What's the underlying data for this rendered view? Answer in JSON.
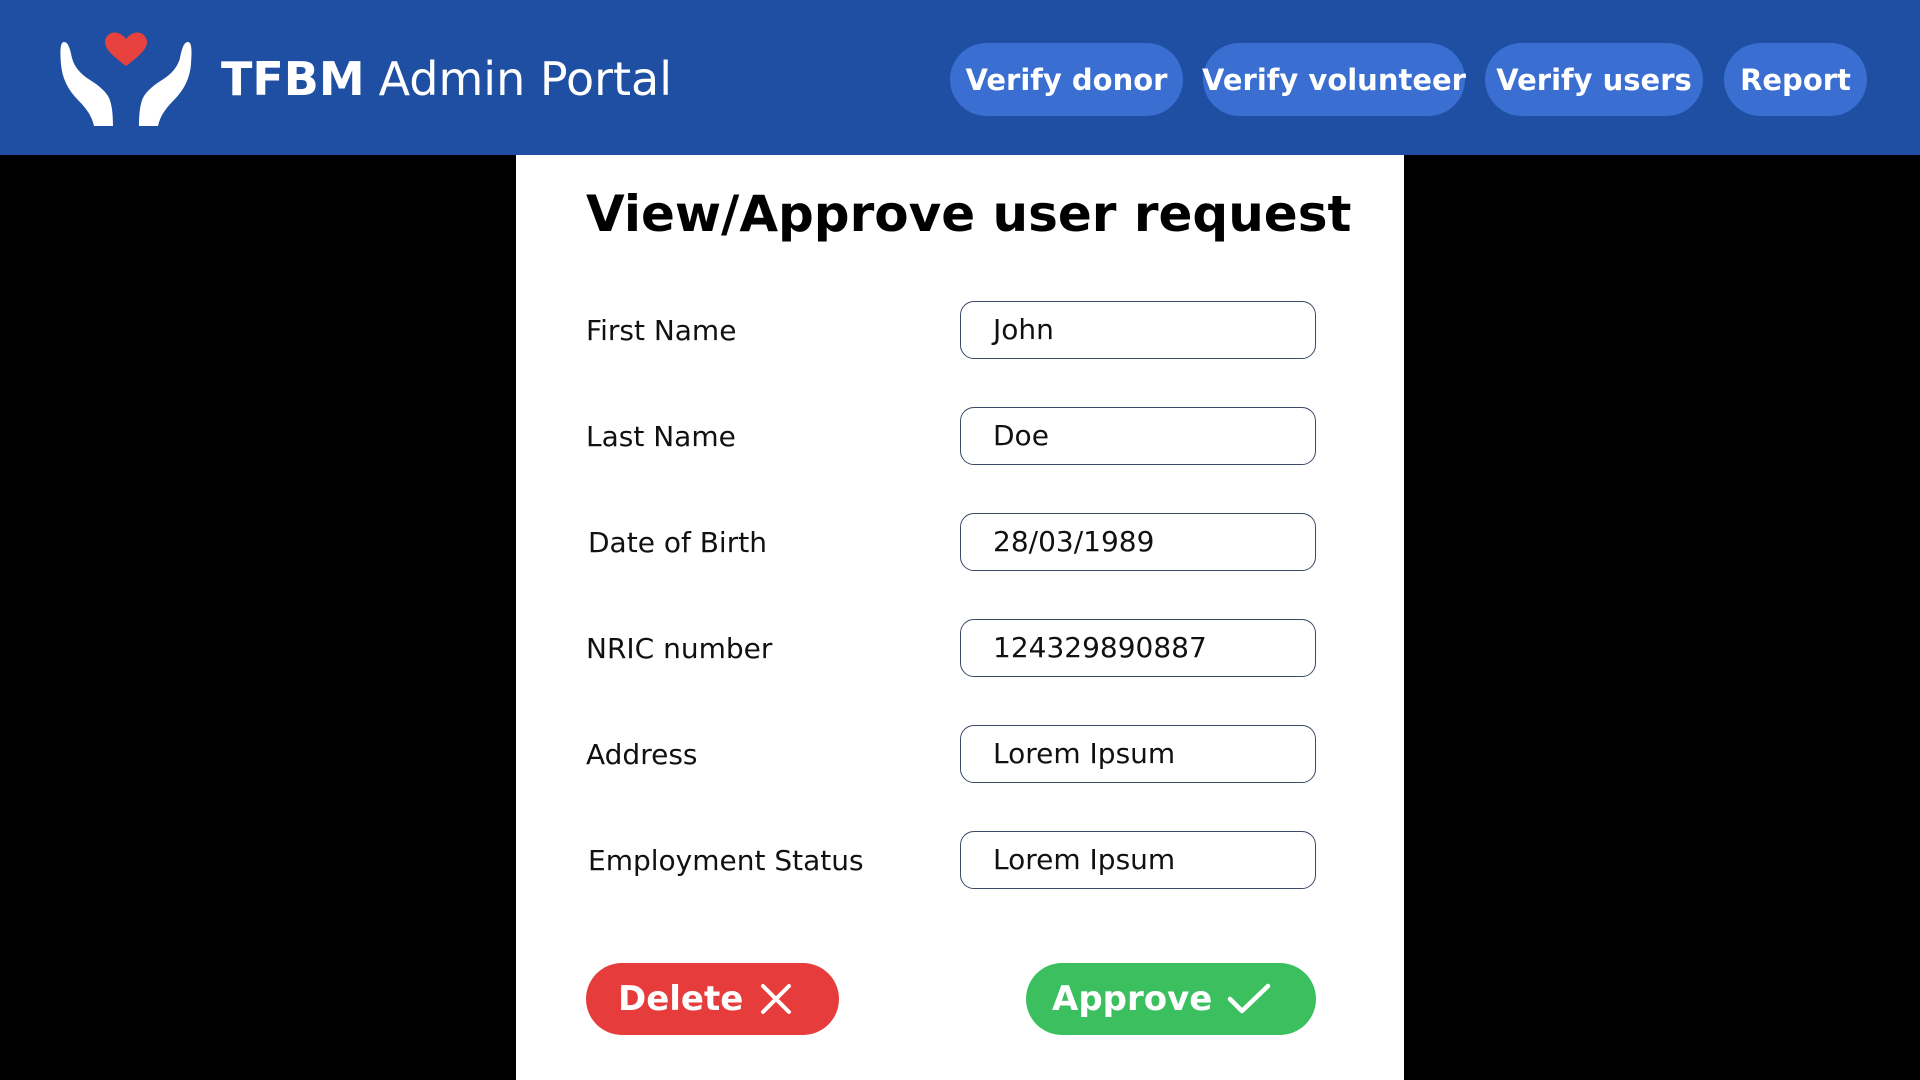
{
  "header": {
    "brand_strong": "TFBM",
    "brand_rest": "Admin Portal",
    "logo_icon": "heart-hands-logo",
    "colors": {
      "bar": "#1f4fa3",
      "nav_button": "#3a6fd1",
      "heart": "#e8423f"
    },
    "nav": [
      {
        "label": "Verify donor"
      },
      {
        "label": "Verify volunteer"
      },
      {
        "label": "Verify users"
      },
      {
        "label": "Report"
      }
    ]
  },
  "form": {
    "title": "View/Approve user request",
    "rows": [
      {
        "label": "First Name",
        "value": "John"
      },
      {
        "label": "Last Name",
        "value": "Doe"
      },
      {
        "label": "Date of Birth",
        "value": "28/03/1989"
      },
      {
        "label": "NRIC number",
        "value": "124329890887"
      },
      {
        "label": "Address",
        "value": "Lorem Ipsum"
      },
      {
        "label": "Employment Status",
        "value": "Lorem Ipsum"
      }
    ],
    "delete_label": "Delete",
    "delete_icon": "close-icon",
    "approve_label": "Approve",
    "approve_icon": "checkmark-icon",
    "colors": {
      "delete": "#e63c3c",
      "approve": "#3cc05f"
    }
  }
}
